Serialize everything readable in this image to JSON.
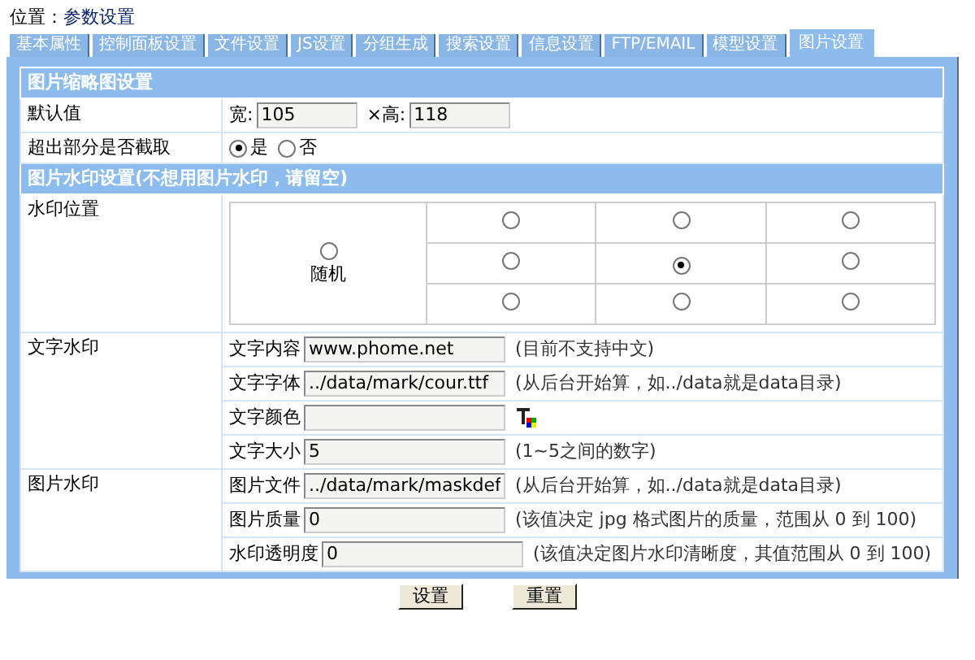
{
  "breadcrumb": {
    "label": "位置：",
    "link": "参数设置"
  },
  "tabs": [
    {
      "label": "基本属性",
      "selected": false
    },
    {
      "label": "控制面板设置",
      "selected": false
    },
    {
      "label": "文件设置",
      "selected": false
    },
    {
      "label": "JS设置",
      "selected": false
    },
    {
      "label": "分组生成",
      "selected": false
    },
    {
      "label": "搜索设置",
      "selected": false
    },
    {
      "label": "信息设置",
      "selected": false
    },
    {
      "label": "FTP/EMAIL",
      "selected": false
    },
    {
      "label": "模型设置",
      "selected": false
    },
    {
      "label": "图片设置",
      "selected": true
    }
  ],
  "sections": [
    {
      "title": "图片缩略图设置",
      "rows": [
        {
          "kind": "size",
          "label": "默认值",
          "fields": [
            {
              "label": "宽:",
              "value": "105"
            },
            {
              "label": "×高:",
              "value": "118"
            }
          ]
        },
        {
          "kind": "radio",
          "label": "超出部分是否截取",
          "options": [
            {
              "label": "是",
              "selected": true
            },
            {
              "label": "否",
              "selected": false
            }
          ]
        }
      ]
    },
    {
      "title": "图片水印设置(不想用图片水印，请留空)",
      "rows": [
        {
          "kind": "grid",
          "label": "水印位置",
          "random": {
            "label": "随机",
            "selected": false
          },
          "positions": [
            {
              "selected": false
            },
            {
              "selected": false
            },
            {
              "selected": false
            },
            {
              "selected": false
            },
            {
              "selected": true
            },
            {
              "selected": false
            },
            {
              "selected": false
            },
            {
              "selected": false
            },
            {
              "selected": false
            }
          ]
        },
        {
          "kind": "fields",
          "label": "文字水印",
          "fields": [
            {
              "kind": "text",
              "label": "文字内容",
              "value": "www.phome.net",
              "note": "(目前不支持中文)"
            },
            {
              "kind": "text",
              "label": "文字字体",
              "value": "../data/mark/cour.ttf",
              "note": "(从后台开始算，如../data就是data目录)"
            },
            {
              "kind": "color",
              "label": "文字颜色"
            },
            {
              "kind": "text",
              "label": "文字大小",
              "value": "5",
              "note": "(1~5之间的数字)"
            }
          ]
        },
        {
          "kind": "fields",
          "label": "图片水印",
          "fields": [
            {
              "kind": "text",
              "label": "图片文件",
              "value": "../data/mark/maskdef",
              "note": "(从后台开始算，如../data就是data目录)"
            },
            {
              "kind": "text",
              "label": "图片质量",
              "value": "0",
              "note": "(该值决定 jpg 格式图片的质量，范围从 0 到 100)"
            },
            {
              "kind": "text",
              "label": "水印透明度",
              "value": "0",
              "note": "(该值决定图片水印清晰度，其值范围从 0 到 100)"
            }
          ]
        }
      ]
    }
  ],
  "buttons": [
    "设置",
    "重置"
  ]
}
